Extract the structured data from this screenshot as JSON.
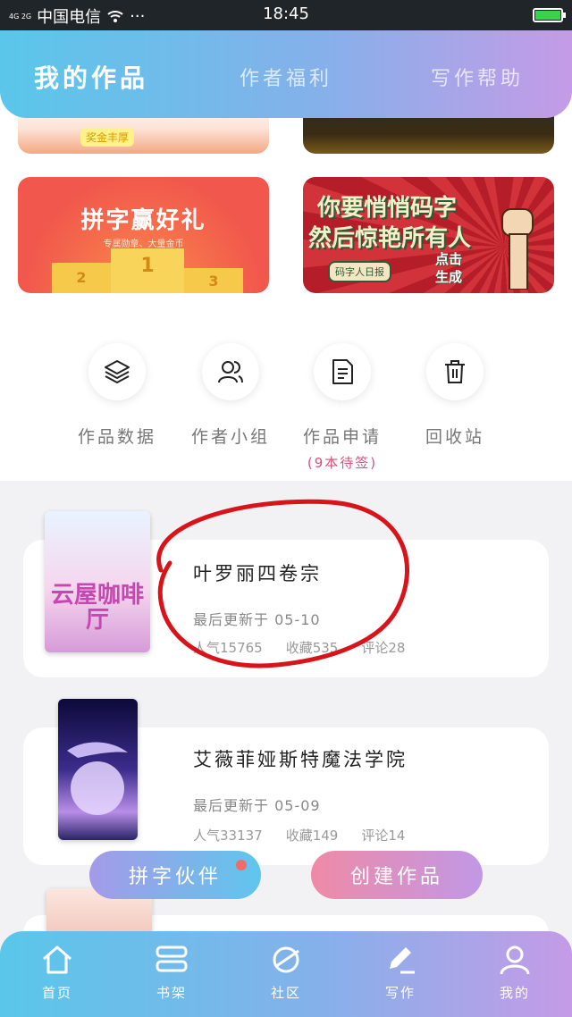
{
  "status_bar": {
    "signal": "4G 2G",
    "carrier": "中国电信",
    "wifi_icon": "wifi-icon",
    "more": "···",
    "time": "18:45"
  },
  "header": {
    "tabs": [
      {
        "label": "我的作品",
        "active": true
      },
      {
        "label": "作者福利",
        "active": false
      },
      {
        "label": "写作帮助",
        "active": false
      }
    ]
  },
  "banners": {
    "top_left_tag": "奖金丰厚",
    "pinzi": {
      "title": "拼字赢好礼",
      "subtitle": "专属勋章、大量金币",
      "ranks": [
        "2",
        "1",
        "3"
      ]
    },
    "promo": {
      "line1": "你要悄悄码字",
      "line2": "然后惊艳所有人",
      "stamp": "码字人日报",
      "cta_line1": "点击",
      "cta_line2": "生成"
    }
  },
  "quick_actions": [
    {
      "label": "作品数据",
      "icon": "layers-icon"
    },
    {
      "label": "作者小组",
      "icon": "people-icon"
    },
    {
      "label": "作品申请",
      "icon": "document-icon",
      "note": "(9本待签)"
    },
    {
      "label": "回收站",
      "icon": "trash-icon"
    }
  ],
  "works": [
    {
      "title": "叶罗丽四卷宗",
      "updated": "最后更新于 05-10",
      "stats": [
        "人气15765",
        "收藏535",
        "评论28"
      ],
      "cover_text": "云屋咖啡厅"
    },
    {
      "title": "艾薇菲娅斯特魔法学院",
      "updated": "最后更新于 05-09",
      "stats": [
        "人气33137",
        "收藏149",
        "评论14"
      ]
    }
  ],
  "floating_buttons": {
    "partner": "拼字伙伴",
    "create": "创建作品"
  },
  "bottom_nav": [
    {
      "label": "首页",
      "icon": "home-icon"
    },
    {
      "label": "书架",
      "icon": "bookshelf-icon"
    },
    {
      "label": "社区",
      "icon": "planet-icon"
    },
    {
      "label": "写作",
      "icon": "pen-icon"
    },
    {
      "label": "我的",
      "icon": "user-icon"
    }
  ],
  "colors": {
    "header_gradient_start": "#5ac7ea",
    "header_gradient_end": "#c59be6",
    "note_pink": "#d9507a",
    "annotation_red": "#d8141a"
  }
}
